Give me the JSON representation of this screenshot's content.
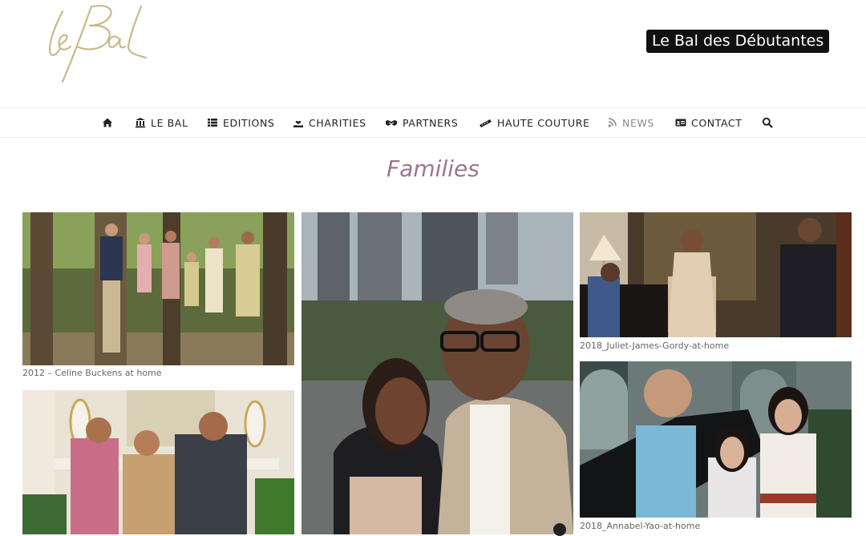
{
  "header": {
    "logo_text": "le Bal",
    "tagline": "Le Bal des Débutantes"
  },
  "nav": {
    "items": [
      {
        "label": "",
        "icon": "home-icon"
      },
      {
        "label": "LE BAL",
        "icon": "bank-icon"
      },
      {
        "label": "EDITIONS",
        "icon": "list-icon"
      },
      {
        "label": "CHARITIES",
        "icon": "hand-heart-icon"
      },
      {
        "label": "PARTNERS",
        "icon": "handshake-icon"
      },
      {
        "label": "HAUTE COUTURE",
        "icon": "tape-measure-icon"
      },
      {
        "label": "NEWS",
        "icon": "rss-icon",
        "active": true
      },
      {
        "label": "CONTACT",
        "icon": "id-card-icon"
      },
      {
        "label": "",
        "icon": "search-icon"
      }
    ]
  },
  "page": {
    "title": "Families"
  },
  "gallery": {
    "captions": {
      "celine": "2012 – Celine Buckens at home",
      "juliet": "2018_Juliet-James-Gordy-at-home",
      "annabel": "2018_Annabel-Yao-at-home"
    }
  },
  "colors": {
    "title": "#9b7590",
    "logo": "#c9b98a",
    "tagline_bg": "#111111"
  }
}
